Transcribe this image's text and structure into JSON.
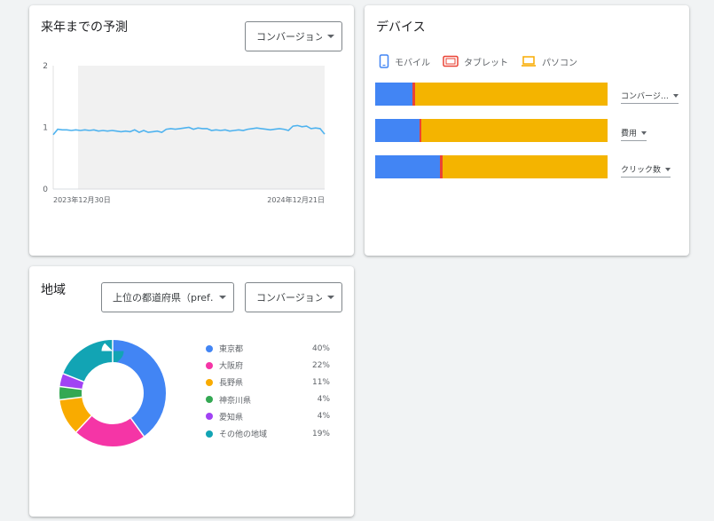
{
  "forecast": {
    "title": "来年までの予測",
    "dropdown_label": "コンバージョン",
    "chart_data": {
      "type": "line",
      "y_ticks": [
        "0",
        "1",
        "2"
      ],
      "ylim": [
        0,
        2
      ],
      "x_labels": [
        "2023年12月30日",
        "2024年12月21日"
      ],
      "shaded_region": "forecast",
      "series": [
        {
          "values": [
            0.88,
            0.97,
            0.96,
            0.96,
            0.95,
            0.96,
            0.95,
            0.96,
            0.95,
            0.96,
            0.94,
            0.95,
            0.94,
            0.95,
            0.94,
            0.93,
            0.94,
            0.93,
            0.96,
            0.92,
            0.95,
            0.92,
            0.93,
            0.94,
            0.92,
            0.97,
            0.98,
            0.97,
            0.98,
            0.99,
            1.0,
            0.97,
            0.99,
            0.98,
            0.98,
            0.95,
            0.96,
            0.95,
            0.96,
            0.94,
            0.95,
            0.96,
            0.95,
            0.97,
            0.98,
            0.99,
            0.98,
            0.97,
            0.96,
            0.97,
            0.98,
            0.97,
            0.95,
            1.02,
            1.03,
            1.01,
            1.02,
            0.98,
            0.99,
            0.98,
            0.89
          ],
          "color": "#4fb3ef"
        }
      ]
    }
  },
  "device": {
    "title": "デバイス",
    "legend": [
      {
        "label": "モバイル",
        "color": "#4285f4",
        "icon": "phone-icon"
      },
      {
        "label": "タブレット",
        "color": "#ea4335",
        "icon": "tablet-icon"
      },
      {
        "label": "パソコン",
        "color": "#f9ab00",
        "icon": "laptop-icon"
      }
    ],
    "chart_data": {
      "type": "bar",
      "stacked": true,
      "categories": [
        "コンバージ…",
        "費用",
        "クリック数"
      ],
      "series": [
        {
          "name": "モバイル",
          "values": [
            16,
            19,
            28
          ],
          "color": "#4285f4"
        },
        {
          "name": "タブレット",
          "values": [
            1,
            1,
            1
          ],
          "color": "#ea4335"
        },
        {
          "name": "パソコン",
          "values": [
            83,
            80,
            71
          ],
          "color": "#f4b400"
        }
      ]
    },
    "metric_labels": [
      "コンバージ…",
      "費用",
      "クリック数"
    ]
  },
  "region": {
    "title": "地域",
    "dropdown_pref": "上位の都道府県（pref…",
    "dropdown_metric": "コンバージョン",
    "chart_data": {
      "type": "pie",
      "donut": true,
      "labels": [
        "東京都",
        "大阪府",
        "長野県",
        "神奈川県",
        "愛知県",
        "その他の地域"
      ],
      "values": [
        40,
        22,
        11,
        4,
        4,
        19
      ],
      "display_values": [
        "40%",
        "22%",
        "11%",
        "4%",
        "4%",
        "19%"
      ],
      "colors": [
        "#4285f4",
        "#f535a6",
        "#f9ab00",
        "#34a853",
        "#a142f4",
        "#12a4b4"
      ]
    }
  }
}
